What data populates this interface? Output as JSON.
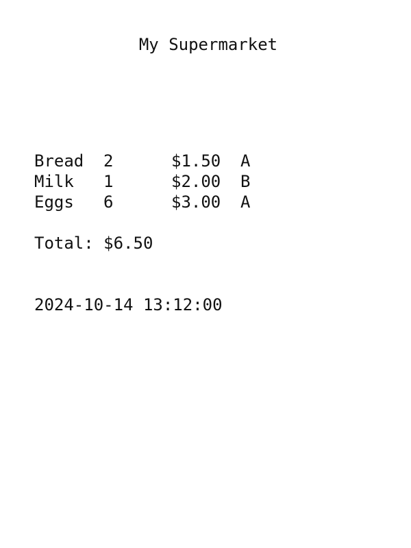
{
  "receipt": {
    "store_name": "My Supermarket",
    "items": [
      {
        "name": "Bread",
        "qty": "2",
        "price": "$1.50",
        "code": "A"
      },
      {
        "name": "Milk",
        "qty": "1",
        "price": "$2.00",
        "code": "B"
      },
      {
        "name": "Eggs",
        "qty": "6",
        "price": "$3.00",
        "code": "A"
      }
    ],
    "total": "Total: $6.50",
    "timestamp": "2024-10-14 13:12:00"
  }
}
